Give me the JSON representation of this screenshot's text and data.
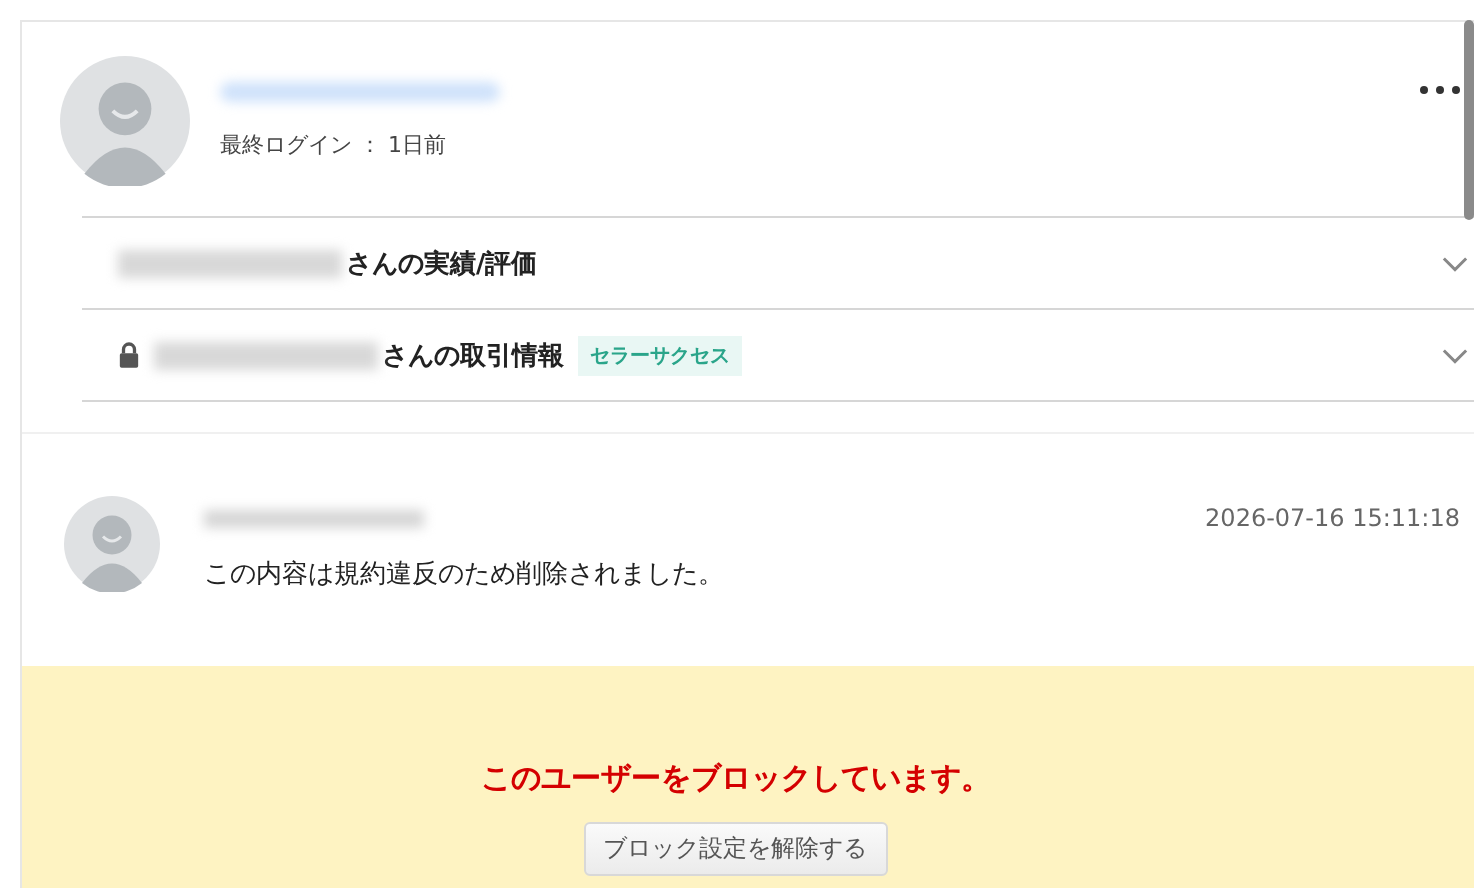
{
  "profile": {
    "last_login_label": "最終ログイン",
    "last_login_separator": "：",
    "last_login_value": "1日前"
  },
  "sections": [
    {
      "title": "さんの実績/評価",
      "locked": false,
      "expanded": false
    },
    {
      "title": "さんの取引情報",
      "locked": true,
      "expanded": false,
      "badge": "セラーサクセス"
    }
  ],
  "message": {
    "timestamp": "2026-07-16 15:11:18",
    "text": "この内容は規約違反のため削除されました。"
  },
  "block_notice": {
    "text": "このユーザーをブロックしています。",
    "button": "ブロック設定を解除する"
  }
}
